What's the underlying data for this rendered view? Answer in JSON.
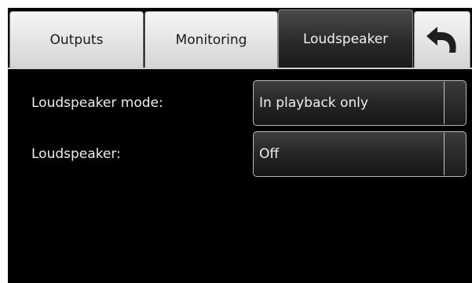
{
  "tabs": [
    {
      "label": "Outputs",
      "active": false
    },
    {
      "label": "Monitoring",
      "active": false
    },
    {
      "label": "Loudspeaker",
      "active": true
    }
  ],
  "back_button": {
    "icon": "undo-arrow-icon"
  },
  "settings": {
    "loudspeaker_mode": {
      "label": "Loudspeaker mode:",
      "value": "In playback only"
    },
    "loudspeaker": {
      "label": "Loudspeaker:",
      "value": "Off"
    }
  },
  "colors": {
    "background": "#000000",
    "inactive_tab": "#e4e4e4",
    "active_tab": "#2a2a2a",
    "text_light": "#ececec",
    "text_dark": "#1a1a1a"
  }
}
